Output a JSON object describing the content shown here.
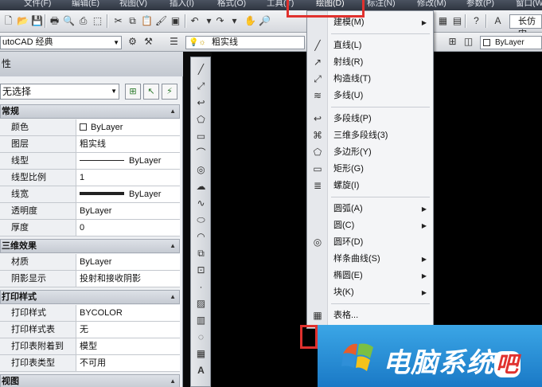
{
  "menubar": {
    "items": [
      "文件(F)",
      "编辑(E)",
      "视图(V)",
      "插入(I)",
      "格式(O)",
      "工具(T)",
      "绘图(D)",
      "标注(N)",
      "修改(M)",
      "参数(P)",
      "窗口(W)"
    ],
    "open_menu": "绘图(D)"
  },
  "toolbar2": {
    "workspace": "utoCAD 经典",
    "layer": "粗实线",
    "linetype": "ByLayer"
  },
  "toolbar1": {
    "text_style": "长仿宋"
  },
  "properties": {
    "title": "性",
    "selection": "无选择",
    "sections": [
      {
        "title": "常规",
        "rows": [
          {
            "name": "颜色",
            "value": "ByLayer",
            "kind": "color"
          },
          {
            "name": "图层",
            "value": "粗实线"
          },
          {
            "name": "线型",
            "value": "ByLayer",
            "kind": "line"
          },
          {
            "name": "线型比例",
            "value": "1"
          },
          {
            "name": "线宽",
            "value": "ByLayer",
            "kind": "thick"
          },
          {
            "name": "透明度",
            "value": "ByLayer"
          },
          {
            "name": "厚度",
            "value": "0"
          }
        ]
      },
      {
        "title": "三维效果",
        "rows": [
          {
            "name": "材质",
            "value": "ByLayer"
          },
          {
            "name": "阴影显示",
            "value": "投射和接收阴影"
          }
        ]
      },
      {
        "title": "打印样式",
        "rows": [
          {
            "name": "打印样式",
            "value": "BYCOLOR"
          },
          {
            "name": "打印样式表",
            "value": "无"
          },
          {
            "name": "打印表附着到",
            "value": "模型"
          },
          {
            "name": "打印表类型",
            "value": "不可用"
          }
        ]
      },
      {
        "title": "视图",
        "rows": []
      }
    ]
  },
  "draw_menu": {
    "groups": [
      [
        {
          "label": "建模(M)",
          "submenu": true,
          "icon": "none"
        }
      ],
      [
        {
          "label": "直线(L)",
          "icon": "line-icon"
        },
        {
          "label": "射线(R)",
          "icon": "ray-icon"
        },
        {
          "label": "构造线(T)",
          "icon": "xline-icon"
        },
        {
          "label": "多线(U)",
          "icon": "mline-icon"
        }
      ],
      [
        {
          "label": "多段线(P)",
          "icon": "polyline-icon"
        },
        {
          "label": "三维多段线(3)",
          "icon": "3dpoly-icon"
        },
        {
          "label": "多边形(Y)",
          "icon": "polygon-icon"
        },
        {
          "label": "矩形(G)",
          "icon": "rectangle-icon"
        },
        {
          "label": "螺旋(I)",
          "icon": "helix-icon"
        }
      ],
      [
        {
          "label": "圆弧(A)",
          "submenu": true,
          "icon": "none"
        },
        {
          "label": "圆(C)",
          "submenu": true,
          "icon": "none"
        },
        {
          "label": "圆环(D)",
          "icon": "donut-icon"
        },
        {
          "label": "样条曲线(S)",
          "submenu": true,
          "icon": "none"
        },
        {
          "label": "椭圆(E)",
          "submenu": true,
          "icon": "none"
        },
        {
          "label": "块(K)",
          "submenu": true,
          "icon": "none"
        }
      ],
      [
        {
          "label": "表格...",
          "icon": "table-icon"
        }
      ]
    ]
  },
  "watermark": {
    "text_main": "电脑系统",
    "text_last": "吧"
  },
  "colors": {
    "highlight": "#e0312e",
    "canvas": "#000000",
    "watermark_bg": "#1a79c6"
  }
}
